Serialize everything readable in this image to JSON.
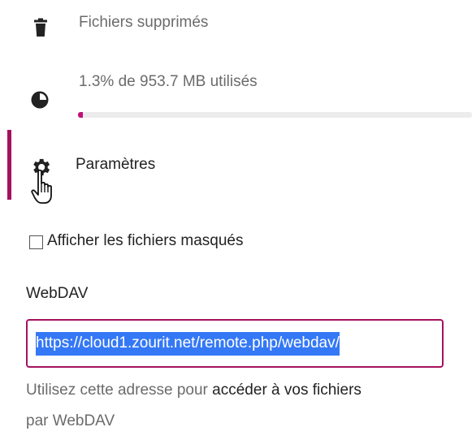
{
  "nav": {
    "deleted_files": {
      "label": "Fichiers supprimés",
      "icon": "trash-icon"
    },
    "quota": {
      "label": "1.3% de 953.7 MB utilisés",
      "icon": "pie-chart-icon",
      "used_percent": 1.3
    },
    "settings": {
      "label": "Paramètres",
      "icon": "gear-icon"
    }
  },
  "settings_panel": {
    "show_hidden_label": "Afficher les fichiers masqués",
    "show_hidden_checked": false,
    "webdav_label": "WebDAV",
    "webdav_url": "https://cloud1.zourit.net/remote.php/webdav/",
    "help_prefix": "Utilisez cette adresse pour ",
    "help_emphasis": "accéder à vos fichiers",
    "help_suffix": "par WebDAV"
  },
  "colors": {
    "accent": "#a5115f",
    "progress": "#c2127a",
    "selection": "#3478f6"
  },
  "cursor": "hand-pointer-icon"
}
